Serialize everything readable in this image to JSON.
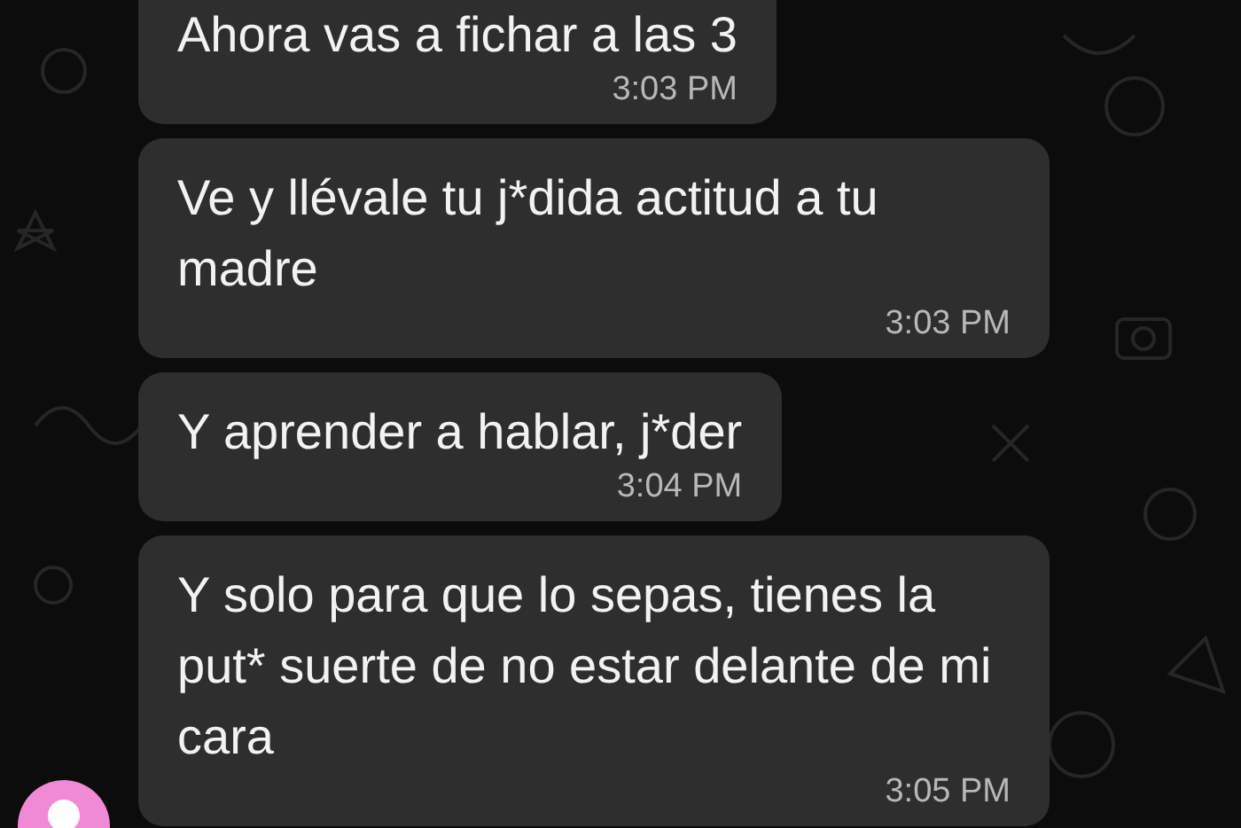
{
  "messages": [
    {
      "text": "Ahora vas a fichar a las 3",
      "time": "3:03 PM",
      "avatar": false
    },
    {
      "text": "Ve y llévale tu j*dida actitud a tu madre",
      "time": "3:03 PM",
      "avatar": false
    },
    {
      "text": "Y aprender a hablar, j*der",
      "time": "3:04 PM",
      "avatar": false
    },
    {
      "text": "Y solo para que lo sepas, tienes la put* suerte de no estar delante de mi cara",
      "time": "3:05 PM",
      "avatar": true
    }
  ]
}
